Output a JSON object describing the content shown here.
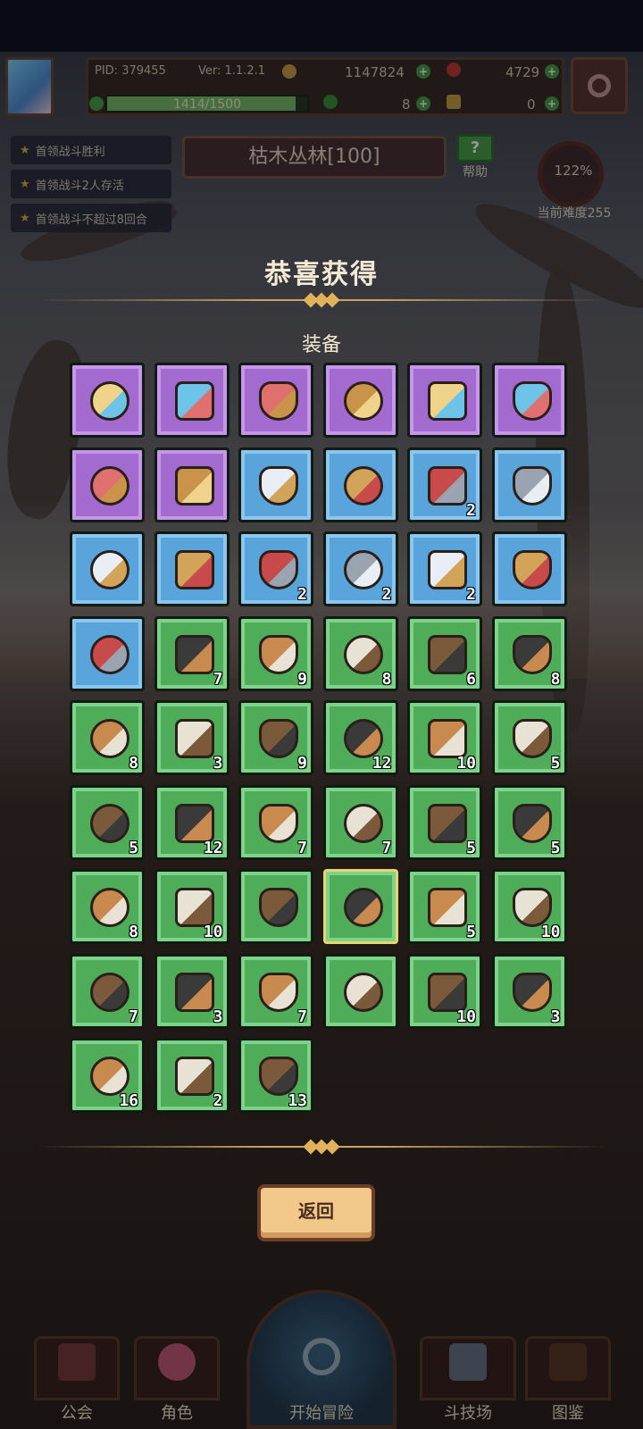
{
  "hud": {
    "pid": "PID: 379455",
    "version": "Ver: 1.1.2.1",
    "gold": "1147824",
    "gems": "4729",
    "xp_text": "1414/1500",
    "xp_progress": 0.9427,
    "clover": "8",
    "hammer": "0"
  },
  "quests": [
    {
      "label": "首领战斗胜利"
    },
    {
      "label": "首领战斗2人存活"
    },
    {
      "label": "首领战斗不超过8回合"
    }
  ],
  "stage": {
    "name": "枯木丛林[100]",
    "help_label": "帮助",
    "difficulty_pct": "122%",
    "difficulty_label": "当前难度255"
  },
  "popup": {
    "title": "恭喜获得",
    "section": "装备",
    "back_label": "返回",
    "items": [
      {
        "rarity": "purple",
        "icon": "staff-icon",
        "count": ""
      },
      {
        "rarity": "purple",
        "icon": "crystal-cloud-icon",
        "count": ""
      },
      {
        "rarity": "purple",
        "icon": "crown-icon",
        "count": ""
      },
      {
        "rarity": "purple",
        "icon": "belt-icon",
        "count": ""
      },
      {
        "rarity": "purple",
        "icon": "gold-boots-icon",
        "count": ""
      },
      {
        "rarity": "purple",
        "icon": "brown-boots-icon",
        "count": ""
      },
      {
        "rarity": "purple",
        "icon": "heart-necklace-icon",
        "count": ""
      },
      {
        "rarity": "purple",
        "icon": "gem-helmet-icon",
        "count": ""
      },
      {
        "rarity": "blue",
        "icon": "shield-icon",
        "count": ""
      },
      {
        "rarity": "blue",
        "icon": "plate-armor-icon",
        "count": ""
      },
      {
        "rarity": "blue",
        "icon": "bracer-icon",
        "count": "2"
      },
      {
        "rarity": "blue",
        "icon": "gauntlet-icon",
        "count": ""
      },
      {
        "rarity": "blue",
        "icon": "silver-boots-icon",
        "count": ""
      },
      {
        "rarity": "blue",
        "icon": "round-shield-icon",
        "count": ""
      },
      {
        "rarity": "blue",
        "icon": "compass-shield-icon",
        "count": "2"
      },
      {
        "rarity": "blue",
        "icon": "silver-necklace-icon",
        "count": "2"
      },
      {
        "rarity": "blue",
        "icon": "gold-bottle-icon",
        "count": "2"
      },
      {
        "rarity": "blue",
        "icon": "ruby-ring-icon",
        "count": ""
      },
      {
        "rarity": "blue",
        "icon": "amethyst-ring-icon",
        "count": ""
      },
      {
        "rarity": "green",
        "icon": "bow-icon",
        "count": "7"
      },
      {
        "rarity": "green",
        "icon": "wooden-staff-icon",
        "count": "9"
      },
      {
        "rarity": "green",
        "icon": "wooden-sword-icon",
        "count": "8"
      },
      {
        "rarity": "green",
        "icon": "steel-sword-icon",
        "count": "6"
      },
      {
        "rarity": "green",
        "icon": "mace-icon",
        "count": "8"
      },
      {
        "rarity": "green",
        "icon": "wooden-shield-icon",
        "count": "8"
      },
      {
        "rarity": "green",
        "icon": "buckler-icon",
        "count": "3"
      },
      {
        "rarity": "green",
        "icon": "orb-icon",
        "count": "9"
      },
      {
        "rarity": "green",
        "icon": "wizard-hat-icon",
        "count": "12"
      },
      {
        "rarity": "green",
        "icon": "hood-icon",
        "count": "10"
      },
      {
        "rarity": "green",
        "icon": "green-robe-icon",
        "count": "5"
      },
      {
        "rarity": "green",
        "icon": "black-armor-icon",
        "count": "5"
      },
      {
        "rarity": "green",
        "icon": "leather-coat-icon",
        "count": "12"
      },
      {
        "rarity": "green",
        "icon": "leather-vest-icon",
        "count": "7"
      },
      {
        "rarity": "green",
        "icon": "silver-armor-icon",
        "count": "7"
      },
      {
        "rarity": "green",
        "icon": "leather-glove-icon",
        "count": "5"
      },
      {
        "rarity": "green",
        "icon": "cloth-glove-icon",
        "count": "5"
      },
      {
        "rarity": "green",
        "icon": "white-glove-icon",
        "count": "8"
      },
      {
        "rarity": "green",
        "icon": "dark-bracer-icon",
        "count": "10"
      },
      {
        "rarity": "green",
        "icon": "white-belt-icon",
        "count": ""
      },
      {
        "rarity": "green",
        "icon": "dark-belt-icon",
        "count": ""
      },
      {
        "rarity": "green",
        "icon": "black-belt-icon",
        "count": "5"
      },
      {
        "rarity": "green",
        "icon": "silver-ring-icon",
        "count": "10"
      },
      {
        "rarity": "green",
        "icon": "sandals-icon",
        "count": "7"
      },
      {
        "rarity": "green",
        "icon": "white-shoes-icon",
        "count": "3"
      },
      {
        "rarity": "green",
        "icon": "leather-boots-icon",
        "count": "7"
      },
      {
        "rarity": "green",
        "icon": "gold-coin-icon",
        "count": ""
      },
      {
        "rarity": "green",
        "icon": "amulet-icon",
        "count": "10"
      },
      {
        "rarity": "green",
        "icon": "cross-necklace-icon",
        "count": "3"
      },
      {
        "rarity": "green",
        "icon": "leaf-necklace-icon",
        "count": "16"
      },
      {
        "rarity": "green",
        "icon": "emerald-ring-icon",
        "count": "2"
      },
      {
        "rarity": "green",
        "icon": "green-crown-icon",
        "count": "13"
      }
    ],
    "selected_index": 39
  },
  "nav": [
    {
      "label": "公会",
      "icon": "guild-icon"
    },
    {
      "label": "角色",
      "icon": "character-icon"
    },
    {
      "label": "开始冒险",
      "icon": "magnifier-icon"
    },
    {
      "label": "斗技场",
      "icon": "crossed-swords-icon"
    },
    {
      "label": "图鉴",
      "icon": "codex-icon"
    }
  ],
  "colors": {
    "purple": "#a36ad0",
    "blue": "#5aa4dc",
    "green": "#4fad5a",
    "button": "#f2c88a"
  }
}
